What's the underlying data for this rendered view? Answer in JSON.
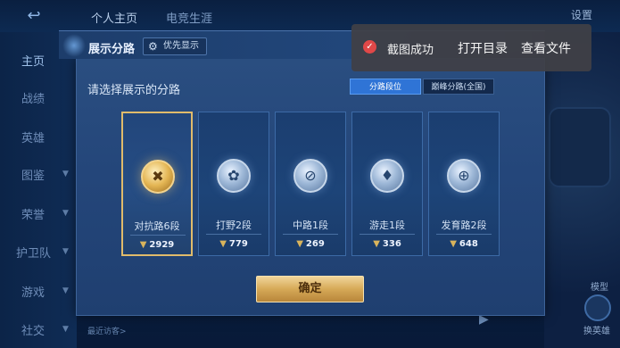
{
  "background": {
    "tabs": [
      "个人主页",
      "电竞生涯"
    ],
    "settings_label": "设置",
    "status_badge": "",
    "sidebar": [
      {
        "label": "主页",
        "arrow": false
      },
      {
        "label": "战绩",
        "arrow": false
      },
      {
        "label": "英雄",
        "arrow": false
      },
      {
        "label": "图鉴",
        "arrow": true
      },
      {
        "label": "荣誉",
        "arrow": true
      },
      {
        "label": "护卫队",
        "arrow": true
      },
      {
        "label": "游戏",
        "arrow": true
      },
      {
        "label": "社交",
        "arrow": true
      }
    ],
    "recent_visit": "最近访客>",
    "model_label": "模型",
    "hero_label": "换英雄"
  },
  "panel": {
    "title": "展示分路",
    "priority_label": "优先显示",
    "prompt": "请选择展示的分路",
    "segments": [
      "分路段位",
      "巅峰分路(全国)"
    ],
    "active_segment": 0,
    "cards": [
      {
        "label": "对抗路6段",
        "score": "2929",
        "emblem": "sword-emblem-icon",
        "selected": true
      },
      {
        "label": "打野2段",
        "score": "779",
        "emblem": "claw-emblem-icon",
        "selected": false
      },
      {
        "label": "中路1段",
        "score": "269",
        "emblem": "staff-emblem-icon",
        "selected": false
      },
      {
        "label": "游走1段",
        "score": "336",
        "emblem": "shield-emblem-icon",
        "selected": false
      },
      {
        "label": "发育路2段",
        "score": "648",
        "emblem": "bow-emblem-icon",
        "selected": false
      }
    ],
    "confirm_label": "确定"
  },
  "toast": {
    "message": "截图成功",
    "open_dir": "打开目录",
    "view_file": "查看文件"
  },
  "colors": {
    "selected_border": "#e0bb6b",
    "segment_active": "#2f74d6",
    "confirm_gold": "#d6a957"
  }
}
